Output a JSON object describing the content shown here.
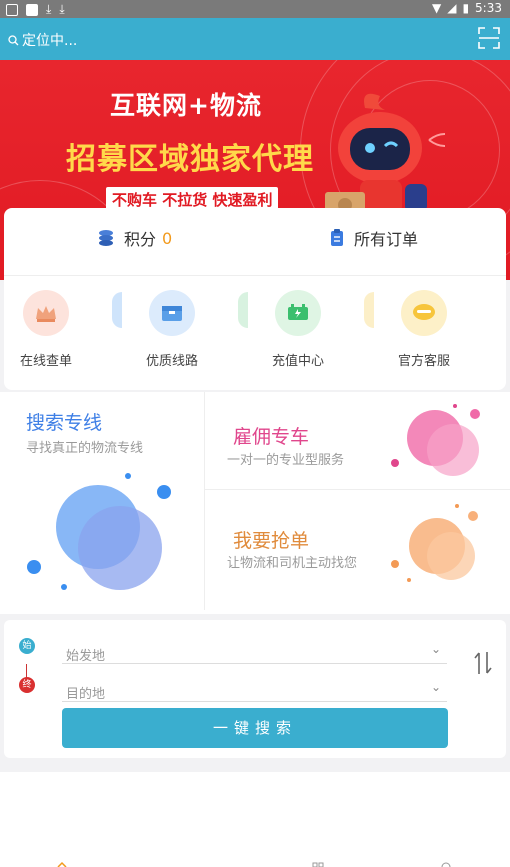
{
  "status_bar": {
    "time": "5:33"
  },
  "header": {
    "location_text": "定位中..."
  },
  "banner": {
    "line1": "互联网+物流",
    "line2": "招募区域独家代理",
    "line3": "不购车 不拉货 快速盈利"
  },
  "account": {
    "points_label": "积分",
    "points_value": "0",
    "orders_label": "所有订单"
  },
  "quick_menu": [
    {
      "label": "在线查单"
    },
    {
      "label": "优质线路"
    },
    {
      "label": "充值中心"
    },
    {
      "label": "官方客服"
    }
  ],
  "features": {
    "search_line": {
      "title": "搜索专线",
      "subtitle": "寻找真正的物流专线"
    },
    "hire_car": {
      "title": "雇佣专车",
      "subtitle": "一对一的专业型服务"
    },
    "grab_order": {
      "title": "我要抢单",
      "subtitle": "让物流和司机主动找您"
    }
  },
  "route_search": {
    "origin_badge": "始",
    "dest_badge": "终",
    "origin_placeholder": "始发地",
    "dest_placeholder": "目的地",
    "button_label": "一键搜索"
  },
  "colors": {
    "primary": "#3aaecf",
    "banner_red": "#e11a23",
    "points_orange": "#f29a1d"
  }
}
